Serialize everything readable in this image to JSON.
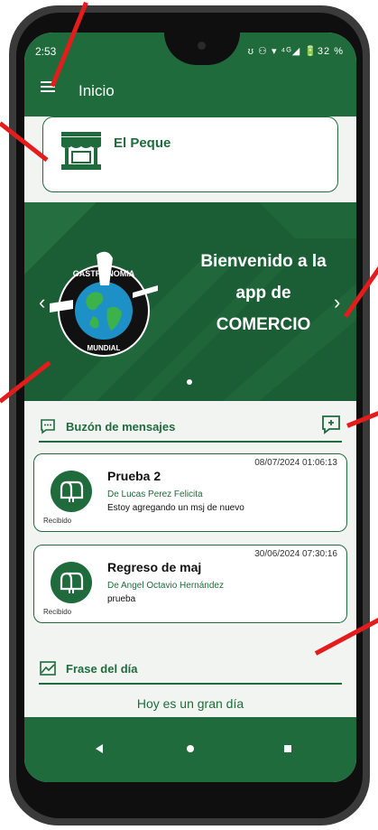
{
  "status_bar": {
    "time": "2:53",
    "icons": "ʊ ⚇ ▾ ⁴ᴳ◢ 🔋32 %"
  },
  "header": {
    "title": "Inicio"
  },
  "store": {
    "name": "El Peque"
  },
  "banner": {
    "line1": "Bienvenido a la",
    "line2": "app de",
    "line3": "COMERCIO",
    "logo_top_text": "GASTRONOMIA",
    "logo_bottom_text": "MUNDIAL"
  },
  "inbox": {
    "title": "Buzón de mensajes",
    "messages": [
      {
        "date": "08/07/2024 01:06:13",
        "title": "Prueba 2",
        "from": "De Lucas Perez Felicita",
        "body": "Estoy agregando un msj de nuevo",
        "status": "Recibido"
      },
      {
        "date": "30/06/2024 07:30:16",
        "title": "Regreso de maj",
        "from": "De Angel Octavio Hernández",
        "body": "prueba",
        "status": "Recibido"
      }
    ]
  },
  "quote": {
    "title": "Frase del día",
    "text": "Hoy es un gran día"
  },
  "colors": {
    "primary": "#1f6b3c",
    "banner": "#1b5e35",
    "annotation": "#e41c1c"
  }
}
